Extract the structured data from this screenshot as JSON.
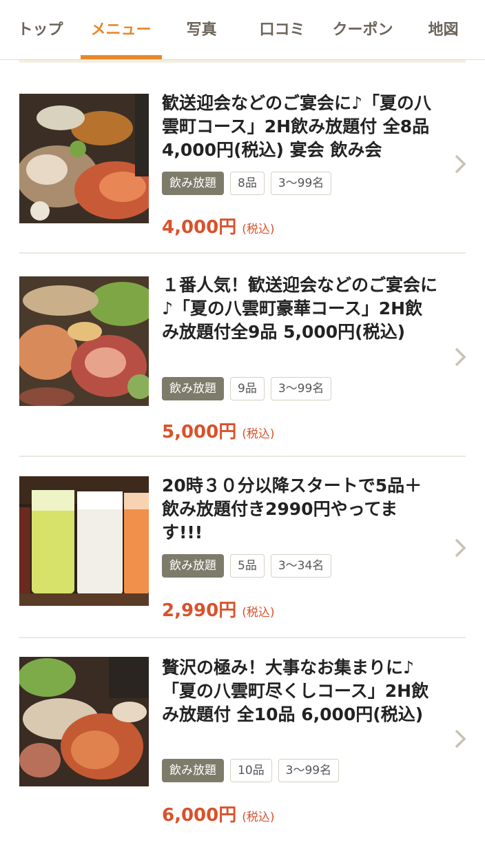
{
  "tabs": [
    {
      "label": "トップ",
      "active": false
    },
    {
      "label": "メニュー",
      "active": true
    },
    {
      "label": "写真",
      "active": false
    },
    {
      "label": "口コミ",
      "active": false
    },
    {
      "label": "クーポン",
      "active": false
    },
    {
      "label": "地図",
      "active": false
    }
  ],
  "colors": {
    "accent": "#e8882a",
    "price": "#d9522b",
    "tag_dark": "#7d7b6a"
  },
  "courses": [
    {
      "title": "歓送迎会などのご宴会に♪「夏の八雲町コース」2H飲み放題付 全8品 4,000円(税込) 宴会 飲み会",
      "tags": [
        "飲み放題",
        "8品",
        "3〜99名"
      ],
      "price": "4,000円",
      "tax": "(税込)",
      "image": "banquet-course-food-photo"
    },
    {
      "title": "１番人気！歓送迎会などのご宴会に♪「夏の八雲町豪華コース」2H飲み放題付全9品 5,000円(税込)",
      "tags": [
        "飲み放題",
        "9品",
        "3〜99名"
      ],
      "price": "5,000円",
      "tax": "(税込)",
      "image": "deluxe-course-food-photo"
    },
    {
      "title": "20時３０分以降スタートで5品＋飲み放題付き2990円やってます!!!",
      "tags": [
        "飲み放題",
        "5品",
        "3〜34名"
      ],
      "price": "2,990円",
      "tax": "(税込)",
      "image": "drinks-photo"
    },
    {
      "title": "贅沢の極み！大事なお集まりに♪「夏の八雲町尽くしコース」2H飲み放題付 全10品 6,000円(税込)",
      "tags": [
        "飲み放題",
        "10品",
        "3〜99名"
      ],
      "price": "6,000円",
      "tax": "(税込)",
      "image": "crab-course-food-photo"
    }
  ]
}
